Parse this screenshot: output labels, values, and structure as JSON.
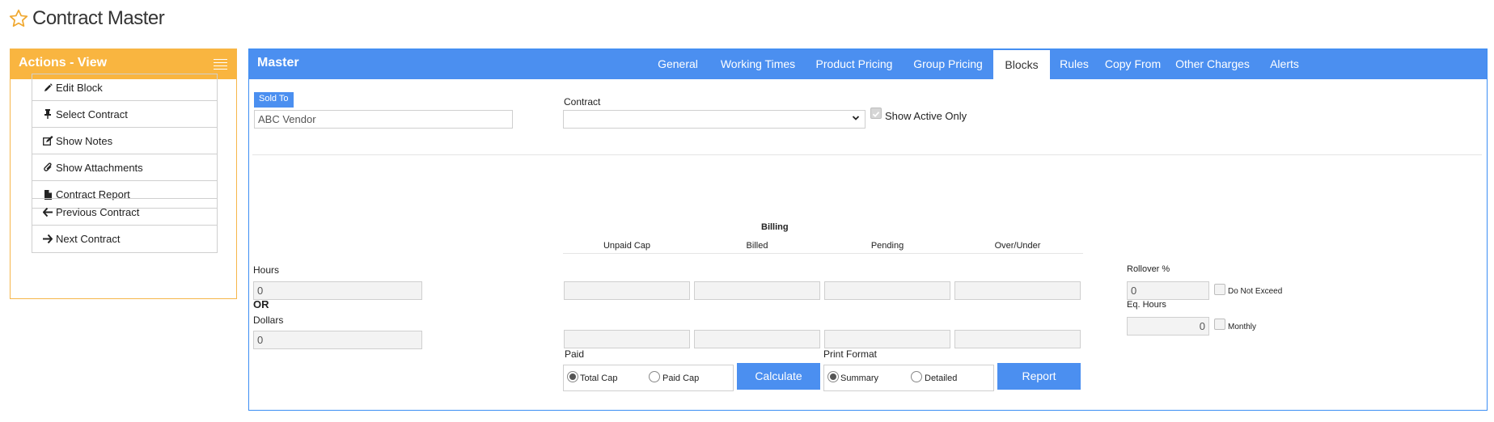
{
  "page": {
    "title": "Contract Master"
  },
  "actions": {
    "header": "Actions - View",
    "group1": [
      {
        "label": "Edit Block",
        "icon": "pencil-icon"
      },
      {
        "label": "Select Contract",
        "icon": "pin-icon"
      },
      {
        "label": "Show Notes",
        "icon": "edit-note-icon"
      },
      {
        "label": "Show Attachments",
        "icon": "paperclip-icon"
      },
      {
        "label": "Contract Report",
        "icon": "file-icon"
      }
    ],
    "group2": [
      {
        "label": "Previous Contract",
        "icon": "arrow-left-icon"
      },
      {
        "label": "Next Contract",
        "icon": "arrow-right-icon"
      }
    ]
  },
  "master": {
    "title": "Master",
    "tabs": [
      "General",
      "Working Times",
      "Product Pricing",
      "Group Pricing",
      "Blocks",
      "Rules",
      "Copy From",
      "Other Charges",
      "Alerts"
    ],
    "active_tab": "Blocks",
    "sold_to": {
      "label": "Sold To",
      "value": "ABC Vendor"
    },
    "contract": {
      "label": "Contract",
      "value": ""
    },
    "show_active_only": {
      "label": "Show Active Only",
      "checked": true
    },
    "hours": {
      "label": "Hours",
      "value": "0"
    },
    "or_label": "OR",
    "dollars": {
      "label": "Dollars",
      "value": "0"
    },
    "billing": {
      "title": "Billing",
      "columns": [
        "Unpaid Cap",
        "Billed",
        "Pending",
        "Over/Under"
      ],
      "hours_row": [
        "",
        "",
        "",
        ""
      ],
      "dollars_row": [
        "",
        "",
        "",
        ""
      ]
    },
    "paid": {
      "label": "Paid",
      "options": [
        "Total Cap",
        "Paid Cap"
      ],
      "selected": "Total Cap"
    },
    "calculate_button": "Calculate",
    "print_format": {
      "label": "Print Format",
      "options": [
        "Summary",
        "Detailed"
      ],
      "selected": "Summary"
    },
    "report_button": "Report",
    "rollover": {
      "label": "Rollover %",
      "value": "0",
      "do_not_exceed_label": "Do Not Exceed",
      "do_not_exceed": false
    },
    "eq_hours": {
      "label": "Eq. Hours",
      "value": "0",
      "monthly_label": "Monthly",
      "monthly": false
    }
  },
  "colors": {
    "brand_blue": "#4b8ff0",
    "actions_orange": "#f9b540",
    "star_orange": "#f0a830"
  }
}
